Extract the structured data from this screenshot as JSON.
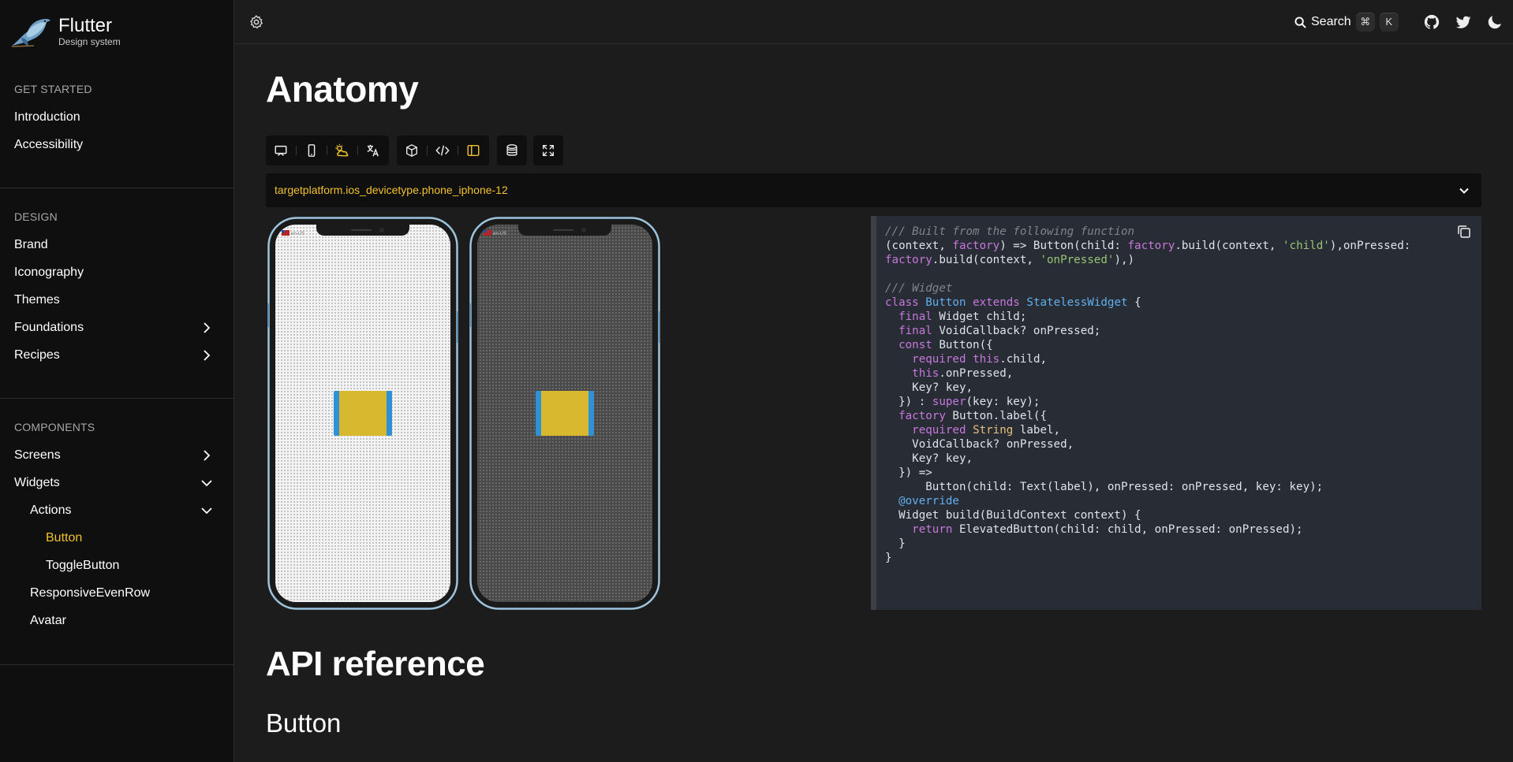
{
  "brand": {
    "name": "Flutter",
    "subtitle": "Design system"
  },
  "sidebar": {
    "sections": [
      {
        "title": "GET STARTED",
        "items": [
          {
            "label": "Introduction"
          },
          {
            "label": "Accessibility"
          }
        ]
      },
      {
        "title": "DESIGN",
        "items": [
          {
            "label": "Brand"
          },
          {
            "label": "Iconography"
          },
          {
            "label": "Themes"
          },
          {
            "label": "Foundations",
            "expandable": true
          },
          {
            "label": "Recipes",
            "expandable": true
          }
        ]
      },
      {
        "title": "COMPONENTS",
        "items": [
          {
            "label": "Screens",
            "expandable": true
          },
          {
            "label": "Widgets",
            "expanded": true
          },
          {
            "label": "Actions",
            "expanded": true,
            "level": 2
          },
          {
            "label": "Button",
            "level": 3,
            "active": true
          },
          {
            "label": "ToggleButton",
            "level": 3
          },
          {
            "label": "ResponsiveEvenRow",
            "level": 2
          },
          {
            "label": "Avatar",
            "level": 2
          }
        ]
      }
    ]
  },
  "topbar": {
    "search_label": "Search",
    "shortcut": [
      "⌘",
      "K"
    ],
    "icons": [
      "settings-icon",
      "github-icon",
      "twitter-icon",
      "dark-mode-icon"
    ]
  },
  "main": {
    "title": "Anatomy",
    "toolbar_icons": [
      "presentation-icon",
      "phone-icon",
      "weather-theme-icon",
      "translate-icon",
      "cube-icon",
      "code-icon",
      "sidebar-layout-icon",
      "database-icon",
      "fullscreen-icon"
    ],
    "device_selector": "targetplatform.ios_devicetype.phone_iphone-12",
    "phones": [
      {
        "theme": "light",
        "locale": "en-US"
      },
      {
        "theme": "dark",
        "locale": "en-US"
      }
    ],
    "api_heading": "API reference",
    "api_subheading": "Button"
  },
  "code_lines": [
    "/// Built from the following function",
    "(context, factory) => Button(child: factory.build(context, 'child'),onPressed:",
    "factory.build(context, 'onPressed'),)",
    "",
    "/// Widget",
    "class Button extends StatelessWidget {",
    "  final Widget child;",
    "  final VoidCallback? onPressed;",
    "  const Button({",
    "    required this.child,",
    "    this.onPressed,",
    "    Key? key,",
    "  }) : super(key: key);",
    "  factory Button.label({",
    "    required String label,",
    "    VoidCallback? onPressed,",
    "    Key? key,",
    "  }) =>",
    "      Button(child: Text(label), onPressed: onPressed, key: key);",
    "  @override",
    "  Widget build(BuildContext context) {",
    "    return ElevatedButton(child: child, onPressed: onPressed);",
    "  }",
    "}"
  ],
  "colors": {
    "accent": "#f2c12e",
    "sidebar_bg": "#0f0f0f",
    "page_bg": "#1c1c1c",
    "code_bg": "#282c34",
    "button_yellow": "#d8b82e",
    "button_blue": "#2f90d6"
  }
}
